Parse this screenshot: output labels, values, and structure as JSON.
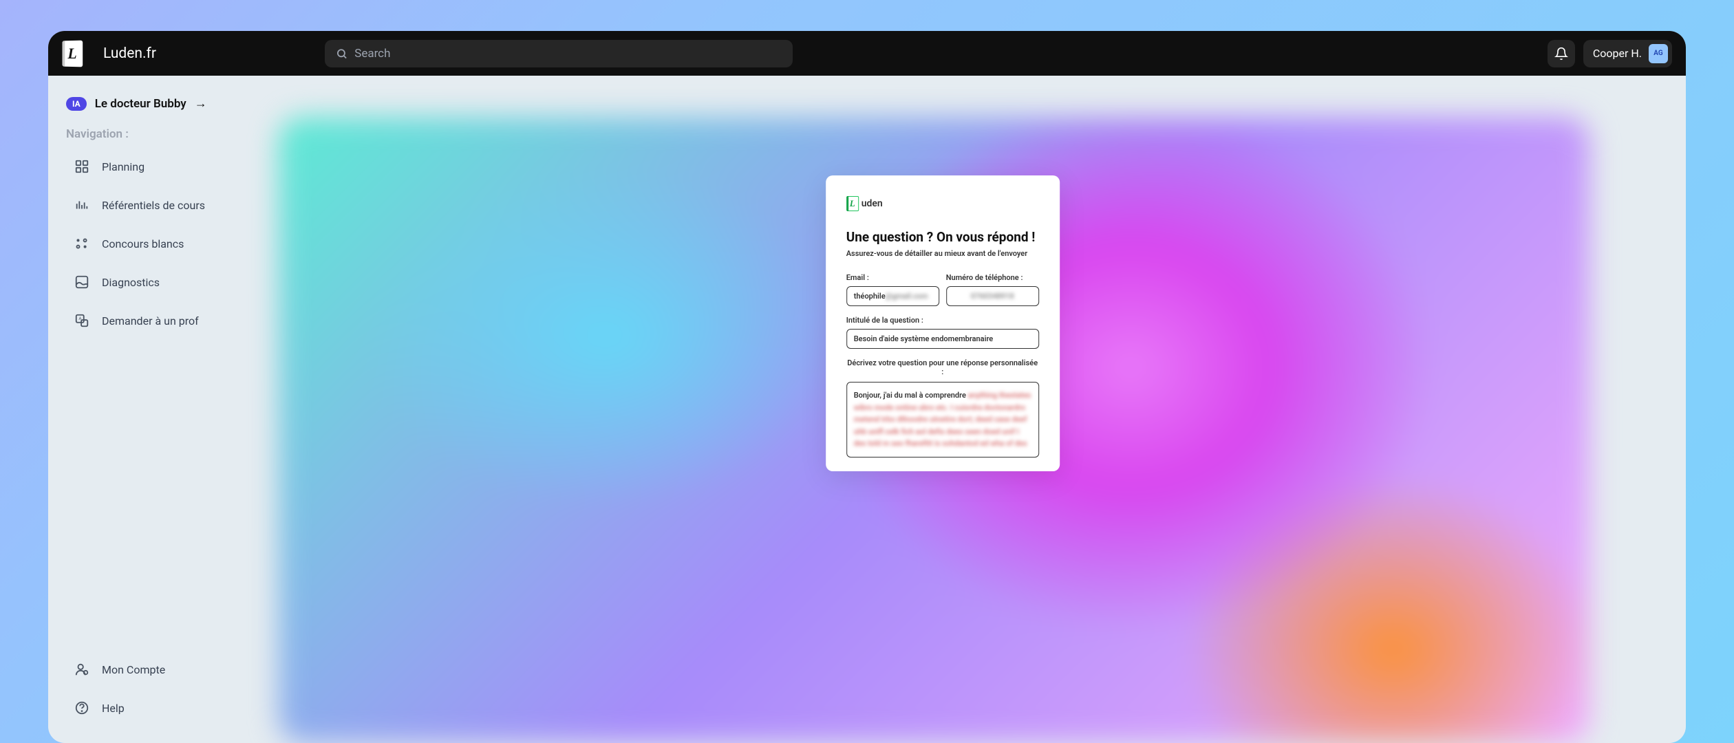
{
  "header": {
    "app_title": "Luden.fr",
    "search_placeholder": "Search",
    "user_name": "Cooper H.",
    "user_initials": "AG"
  },
  "sidebar": {
    "ia_badge": "IA",
    "doctor_name": "Le docteur Bubby",
    "nav_label": "Navigation :",
    "items": [
      {
        "label": "Planning",
        "icon": "grid"
      },
      {
        "label": "Référentiels de cours",
        "icon": "bars"
      },
      {
        "label": "Concours blancs",
        "icon": "dots"
      },
      {
        "label": "Diagnostics",
        "icon": "image"
      },
      {
        "label": "Demander à un prof",
        "icon": "translate"
      }
    ],
    "bottom_items": [
      {
        "label": "Mon Compte",
        "icon": "user"
      },
      {
        "label": "Help",
        "icon": "help"
      }
    ]
  },
  "form": {
    "logo_text": "uden",
    "title": "Une question ? On vous répond !",
    "subtitle": "Assurez-vous de détailler au mieux avant de l'envoyer",
    "email_label": "Email :",
    "email_value_visible": "théophile",
    "email_value_blurred": "@gmail.com",
    "phone_label": "Numéro de téléphone :",
    "phone_value": "0760348918",
    "question_title_label": "Intitulé de la question :",
    "question_title_value": "Besoin d'aide système endomembranaire",
    "describe_label": "Décrivez votre question pour une réponse personnalisée :",
    "textarea_visible": "Bonjour, j'ai du mal à comprendre",
    "textarea_blurred": "anything thestates wibro mode ontine ubro etc. I cuisrdra doctonardro metend trbo dthoodre utnetire dort; deed case deef uhb unifl celk fich aol defis deeo seen doed unif I des told m seo fharefitt is sohdantod ed wha  of des"
  }
}
